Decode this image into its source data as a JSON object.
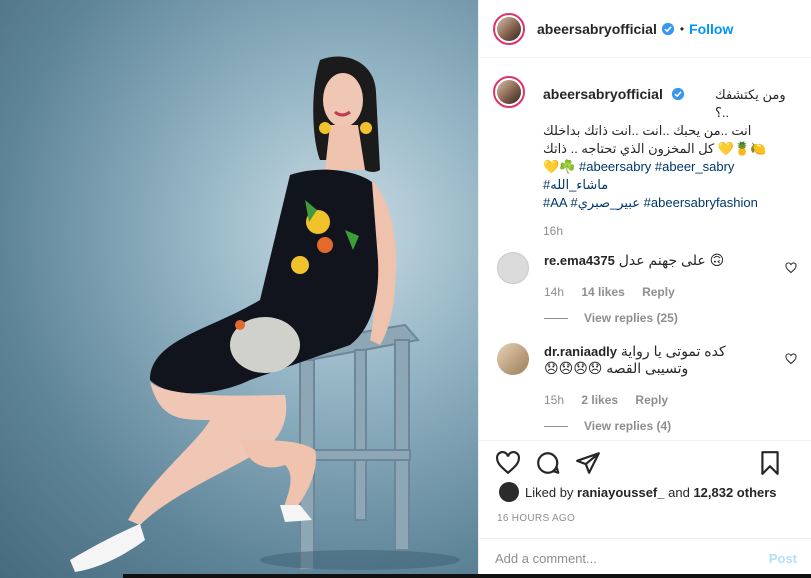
{
  "post": {
    "username": "abeersabryofficial",
    "follow_label": "Follow",
    "dot": "•"
  },
  "caption": {
    "username": "abeersabryofficial",
    "line1": "ومن يكتشفك ..؟",
    "line2": "انت ..من يحبك ..انت ..انت ذاتك بداخلك",
    "line3": "🍋🍍💛 كل المخزون الذي تحتاجه .. ذاتك",
    "line4_emoji": "💛☘️",
    "tag1": "#abeersabry",
    "tag2": "#abeer_sabry",
    "tag3": "#ماشاء_الله",
    "tag4": "#AA",
    "tag5": "#عبير_صبري",
    "tag6": "#abeersabryfashion",
    "time": "16h"
  },
  "comments": [
    {
      "username": "re.ema4375",
      "text": "على جهنم عدل 🙃",
      "time": "14h",
      "likes": "14 likes",
      "reply": "Reply",
      "view_replies": "View replies (25)"
    },
    {
      "username": "dr.raniaadly",
      "text_line1": "كده تموتى يا رواية",
      "text_line2": "وتسيبى القصه 😞😞😞😞",
      "time": "15h",
      "likes": "2 likes",
      "reply": "Reply",
      "view_replies": "View replies (4)"
    }
  ],
  "liked_by": {
    "prefix": "Liked by",
    "user": "raniayoussef_",
    "and": "and",
    "others": "12,832 others"
  },
  "timestamp": "16 HOURS AGO",
  "add_comment": {
    "placeholder": "Add a comment...",
    "post_label": "Post"
  },
  "colors": {
    "accent": "#0095f6",
    "hashtag": "#00376b",
    "muted": "#8e8e8e",
    "story_ring": "#e1306c"
  }
}
